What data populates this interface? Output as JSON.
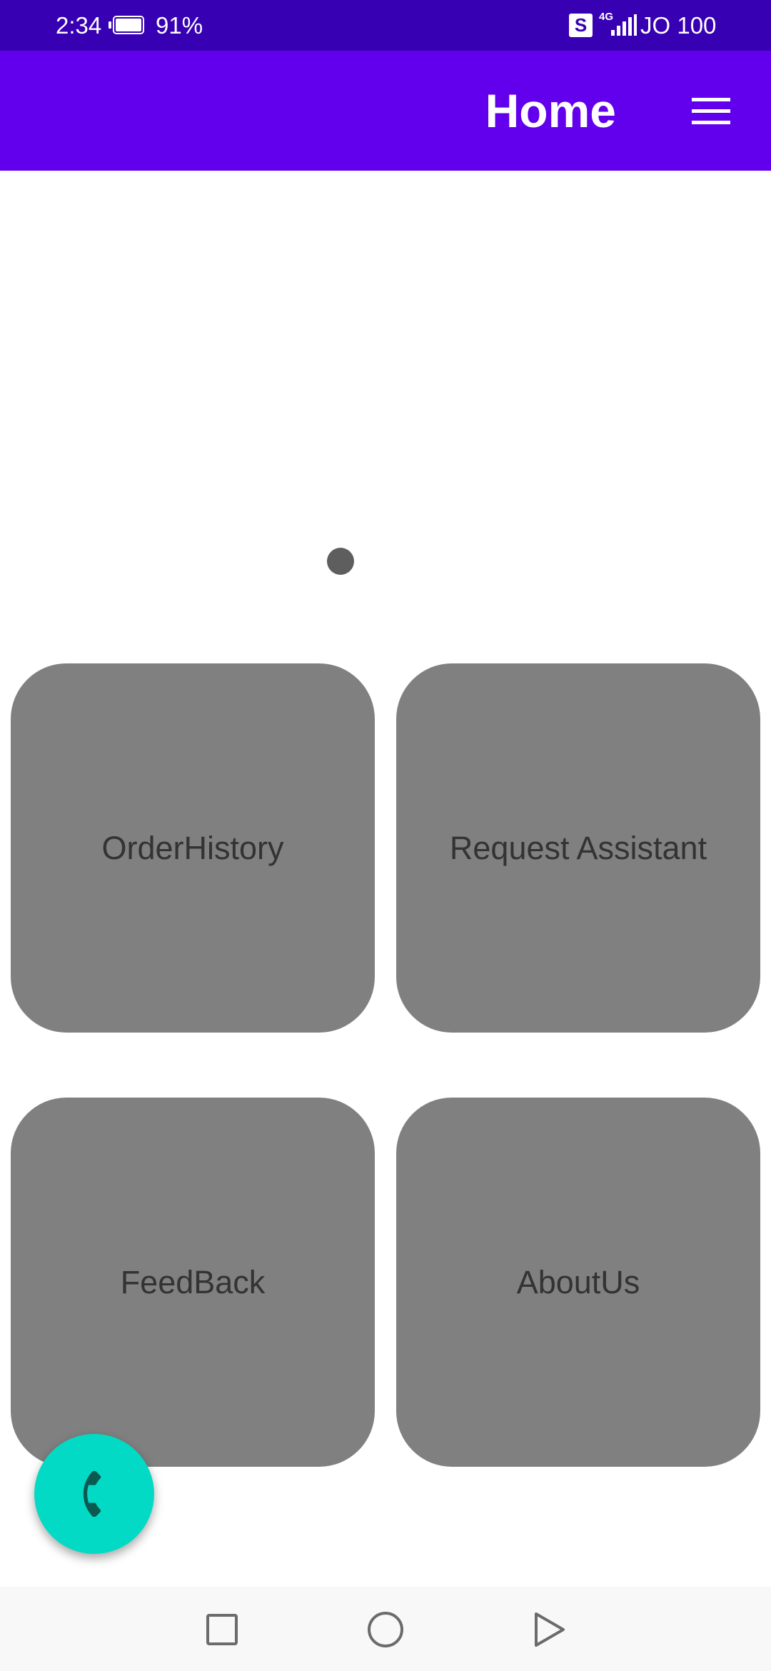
{
  "status_bar": {
    "time": "2:34",
    "battery_percent": "91%",
    "sim_label": "S",
    "network_type": "4G",
    "carrier": "JO 100",
    "battery_level": 0.91
  },
  "app_bar": {
    "title": "Home",
    "menu_icon": "hamburger-menu-icon"
  },
  "banner": {
    "page_count": 1,
    "current_page": 1
  },
  "cards": [
    {
      "label": "OrderHistory"
    },
    {
      "label": "Request Assistant"
    },
    {
      "label": "FeedBack"
    },
    {
      "label": "AboutUs"
    }
  ],
  "fab": {
    "icon": "phone-icon",
    "color": "#03dac5"
  },
  "colors": {
    "status_bar": "#3700b3",
    "app_bar": "#6200ee",
    "card": "#808080",
    "card_text": "#333333"
  },
  "nav_bar": {
    "recents_icon": "square-recents-icon",
    "home_icon": "circle-home-icon",
    "back_icon": "triangle-back-icon"
  }
}
